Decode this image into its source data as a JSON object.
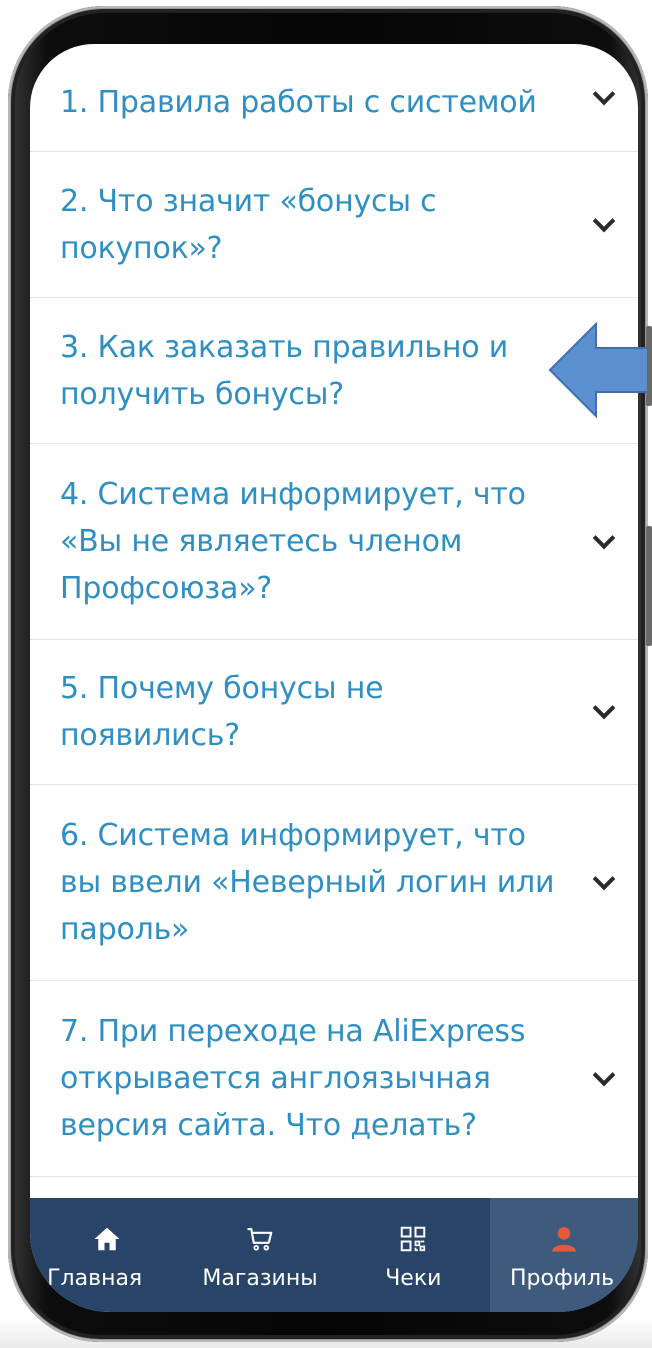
{
  "faq": [
    {
      "text": "1. Правила работы с системой"
    },
    {
      "text": "2. Что значит «бонусы с покупок»?"
    },
    {
      "text": "3. Как заказать правильно и получить бонусы?"
    },
    {
      "text": "4. Система информирует, что «Вы не являетесь членом Профсоюза»?"
    },
    {
      "text": "5. Почему бонусы не появились?"
    },
    {
      "text": "6. Система информирует, что вы ввели «Неверный логин или пароль»"
    },
    {
      "text": "7. При переходе на AliExpress открывается англоязычная версия сайта. Что делать?"
    }
  ],
  "nav": {
    "home": {
      "label": "Главная",
      "icon": "home-icon"
    },
    "shops": {
      "label": "Магазины",
      "icon": "cart-icon"
    },
    "receipts": {
      "label": "Чеки",
      "icon": "qr-icon"
    },
    "profile": {
      "label": "Профиль",
      "icon": "user-icon"
    }
  },
  "colors": {
    "link": "#2f8fc2",
    "nav_bg": "#284569",
    "nav_active": "#3e5a7d",
    "profile_icon": "#e8593a",
    "arrow": "#5b8fd0"
  }
}
